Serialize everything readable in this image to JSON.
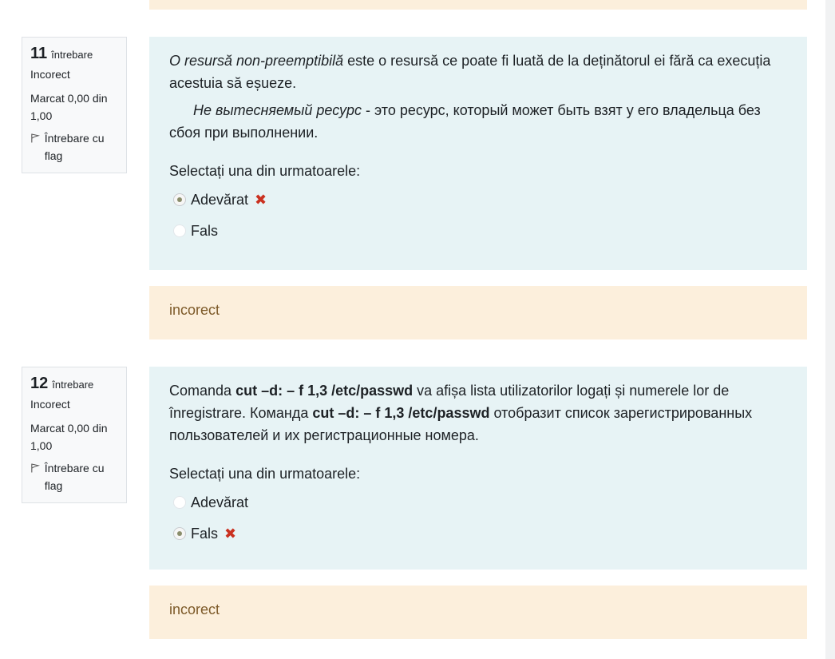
{
  "questions": [
    {
      "number": "11",
      "number_label": "întrebare",
      "state": "Incorect",
      "grade": "Marcat 0,00 din 1,00",
      "flag_label": "Întrebare cu flag",
      "text": {
        "ro_italic": "O resursă non-preemptibilă",
        "ro_rest": " este o resursă ce poate fi luată de la deținătorul ei fără ca execuția acestuia să eșueze.",
        "ru_italic": "Не вытесняемый ресурс",
        "ru_rest": " - это ресурс, который  может быть взят у его владельца без сбоя при  выполнении."
      },
      "prompt": "Selectați una din urmatoarele:",
      "answers": [
        {
          "label": "Adevărat",
          "checked": true,
          "mark": "✖"
        },
        {
          "label": "Fals",
          "checked": false,
          "mark": ""
        }
      ],
      "feedback": "incorect"
    },
    {
      "number": "12",
      "number_label": "întrebare",
      "state": "Incorect",
      "grade": "Marcat 0,00 din 1,00",
      "flag_label": "Întrebare cu flag",
      "text": {
        "p1": "Comanda ",
        "cmd1": "cut  –d:   – f 1,3  /etc/passwd",
        "p2": " va afișa lista utilizatorilor logați și numerele lor de înregistrare.      Команда ",
        "cmd2": "cut  –d:   – f 1,3  /etc/passwd",
        "p3": "  отобразит список зарегистрированных пользователей и их регистрационные номера."
      },
      "prompt": "Selectați una din urmatoarele:",
      "answers": [
        {
          "label": "Adevărat",
          "checked": false,
          "mark": ""
        },
        {
          "label": "Fals",
          "checked": true,
          "mark": "✖"
        }
      ],
      "feedback": "incorect"
    }
  ]
}
